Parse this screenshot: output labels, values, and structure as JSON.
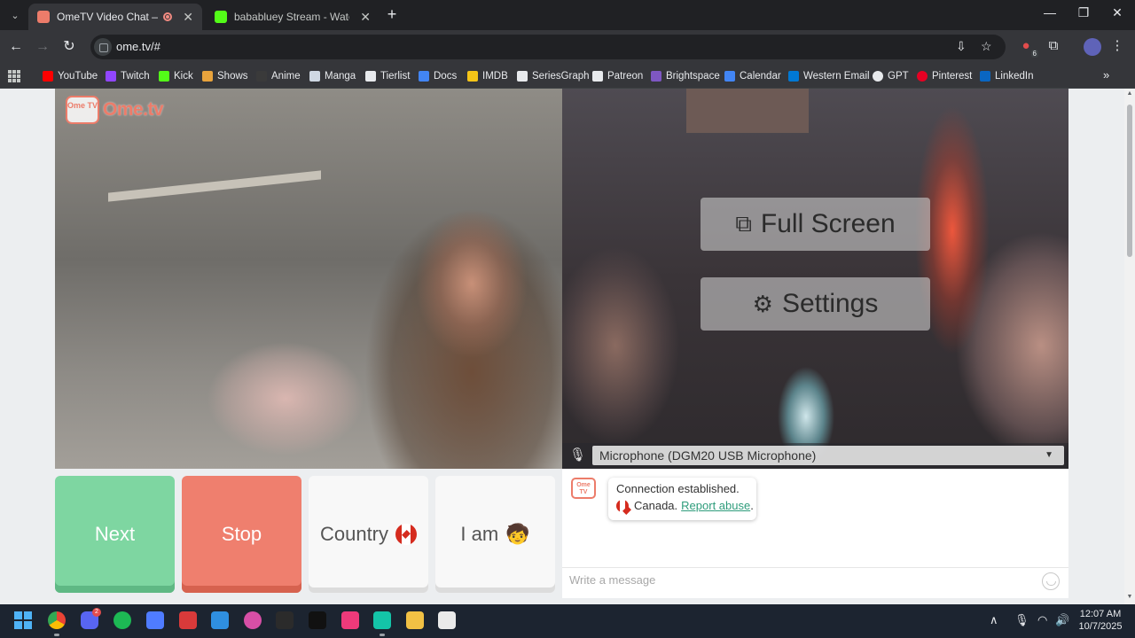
{
  "browser": {
    "tabs": [
      {
        "title": "OmeTV Video Chat — Ome",
        "active": true,
        "favicon_color": "#ec7c6a",
        "recording": true
      },
      {
        "title": "bababluey Stream - Watch Live",
        "active": false,
        "favicon_color": "#53fc18"
      }
    ],
    "url": "ome.tv/#",
    "extension_badge": "6",
    "bookmarks": [
      {
        "label": "YouTube",
        "color": "#ff0000"
      },
      {
        "label": "Twitch",
        "color": "#9146ff"
      },
      {
        "label": "Kick",
        "color": "#53fc18"
      },
      {
        "label": "Shows",
        "color": "#e8a33c"
      },
      {
        "label": "Anime",
        "color": "#3a3a3a"
      },
      {
        "label": "Manga",
        "color": "#cfd8e3"
      },
      {
        "label": "Tierlist",
        "color": "#e8eaed"
      },
      {
        "label": "Docs",
        "color": "#4285f4"
      },
      {
        "label": "IMDB",
        "color": "#f5c518"
      },
      {
        "label": "SeriesGraph",
        "color": "#e8eaed"
      },
      {
        "label": "Patreon",
        "color": "#e8eaed"
      },
      {
        "label": "Brightspace",
        "color": "#7e57c2"
      },
      {
        "label": "Calendar",
        "color": "#4285f4"
      },
      {
        "label": "Western Email",
        "color": "#0078d4"
      },
      {
        "label": "GPT",
        "color": "#e8eaed"
      },
      {
        "label": "Pinterest",
        "color": "#e60023"
      },
      {
        "label": "LinkedIn",
        "color": "#0a66c2"
      }
    ]
  },
  "page": {
    "logo_badge": "Ome TV",
    "logo_text": "Ome.tv",
    "fullscreen_label": "Full Screen",
    "settings_label": "Settings",
    "microphone": "Microphone (DGM20 USB Microphone)",
    "buttons": {
      "next": "Next",
      "stop": "Stop",
      "country": "Country",
      "iam": "I am"
    },
    "chat": {
      "logo_badge": "Ome TV",
      "status": "Connection established.",
      "country": "Canada.",
      "report": "Report abuse",
      "report_suffix": ".",
      "placeholder": "Write a message"
    }
  },
  "taskbar": {
    "discord_badge": "2",
    "time": "12:07 AM",
    "date": "10/7/2025"
  },
  "colors": {
    "brand": "#ec7c6a",
    "next": "#7ed6a1",
    "stop": "#ef7f6e",
    "link": "#2e9c7b"
  }
}
